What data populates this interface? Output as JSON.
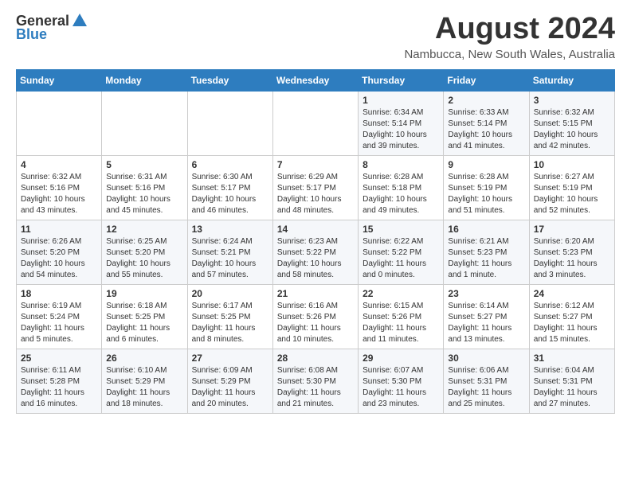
{
  "logo": {
    "general": "General",
    "blue": "Blue"
  },
  "title": "August 2024",
  "subtitle": "Nambucca, New South Wales, Australia",
  "days_of_week": [
    "Sunday",
    "Monday",
    "Tuesday",
    "Wednesday",
    "Thursday",
    "Friday",
    "Saturday"
  ],
  "weeks": [
    [
      {
        "day": "",
        "info": ""
      },
      {
        "day": "",
        "info": ""
      },
      {
        "day": "",
        "info": ""
      },
      {
        "day": "",
        "info": ""
      },
      {
        "day": "1",
        "info": "Sunrise: 6:34 AM\nSunset: 5:14 PM\nDaylight: 10 hours\nand 39 minutes."
      },
      {
        "day": "2",
        "info": "Sunrise: 6:33 AM\nSunset: 5:14 PM\nDaylight: 10 hours\nand 41 minutes."
      },
      {
        "day": "3",
        "info": "Sunrise: 6:32 AM\nSunset: 5:15 PM\nDaylight: 10 hours\nand 42 minutes."
      }
    ],
    [
      {
        "day": "4",
        "info": "Sunrise: 6:32 AM\nSunset: 5:16 PM\nDaylight: 10 hours\nand 43 minutes."
      },
      {
        "day": "5",
        "info": "Sunrise: 6:31 AM\nSunset: 5:16 PM\nDaylight: 10 hours\nand 45 minutes."
      },
      {
        "day": "6",
        "info": "Sunrise: 6:30 AM\nSunset: 5:17 PM\nDaylight: 10 hours\nand 46 minutes."
      },
      {
        "day": "7",
        "info": "Sunrise: 6:29 AM\nSunset: 5:17 PM\nDaylight: 10 hours\nand 48 minutes."
      },
      {
        "day": "8",
        "info": "Sunrise: 6:28 AM\nSunset: 5:18 PM\nDaylight: 10 hours\nand 49 minutes."
      },
      {
        "day": "9",
        "info": "Sunrise: 6:28 AM\nSunset: 5:19 PM\nDaylight: 10 hours\nand 51 minutes."
      },
      {
        "day": "10",
        "info": "Sunrise: 6:27 AM\nSunset: 5:19 PM\nDaylight: 10 hours\nand 52 minutes."
      }
    ],
    [
      {
        "day": "11",
        "info": "Sunrise: 6:26 AM\nSunset: 5:20 PM\nDaylight: 10 hours\nand 54 minutes."
      },
      {
        "day": "12",
        "info": "Sunrise: 6:25 AM\nSunset: 5:20 PM\nDaylight: 10 hours\nand 55 minutes."
      },
      {
        "day": "13",
        "info": "Sunrise: 6:24 AM\nSunset: 5:21 PM\nDaylight: 10 hours\nand 57 minutes."
      },
      {
        "day": "14",
        "info": "Sunrise: 6:23 AM\nSunset: 5:22 PM\nDaylight: 10 hours\nand 58 minutes."
      },
      {
        "day": "15",
        "info": "Sunrise: 6:22 AM\nSunset: 5:22 PM\nDaylight: 11 hours\nand 0 minutes."
      },
      {
        "day": "16",
        "info": "Sunrise: 6:21 AM\nSunset: 5:23 PM\nDaylight: 11 hours\nand 1 minute."
      },
      {
        "day": "17",
        "info": "Sunrise: 6:20 AM\nSunset: 5:23 PM\nDaylight: 11 hours\nand 3 minutes."
      }
    ],
    [
      {
        "day": "18",
        "info": "Sunrise: 6:19 AM\nSunset: 5:24 PM\nDaylight: 11 hours\nand 5 minutes."
      },
      {
        "day": "19",
        "info": "Sunrise: 6:18 AM\nSunset: 5:25 PM\nDaylight: 11 hours\nand 6 minutes."
      },
      {
        "day": "20",
        "info": "Sunrise: 6:17 AM\nSunset: 5:25 PM\nDaylight: 11 hours\nand 8 minutes."
      },
      {
        "day": "21",
        "info": "Sunrise: 6:16 AM\nSunset: 5:26 PM\nDaylight: 11 hours\nand 10 minutes."
      },
      {
        "day": "22",
        "info": "Sunrise: 6:15 AM\nSunset: 5:26 PM\nDaylight: 11 hours\nand 11 minutes."
      },
      {
        "day": "23",
        "info": "Sunrise: 6:14 AM\nSunset: 5:27 PM\nDaylight: 11 hours\nand 13 minutes."
      },
      {
        "day": "24",
        "info": "Sunrise: 6:12 AM\nSunset: 5:27 PM\nDaylight: 11 hours\nand 15 minutes."
      }
    ],
    [
      {
        "day": "25",
        "info": "Sunrise: 6:11 AM\nSunset: 5:28 PM\nDaylight: 11 hours\nand 16 minutes."
      },
      {
        "day": "26",
        "info": "Sunrise: 6:10 AM\nSunset: 5:29 PM\nDaylight: 11 hours\nand 18 minutes."
      },
      {
        "day": "27",
        "info": "Sunrise: 6:09 AM\nSunset: 5:29 PM\nDaylight: 11 hours\nand 20 minutes."
      },
      {
        "day": "28",
        "info": "Sunrise: 6:08 AM\nSunset: 5:30 PM\nDaylight: 11 hours\nand 21 minutes."
      },
      {
        "day": "29",
        "info": "Sunrise: 6:07 AM\nSunset: 5:30 PM\nDaylight: 11 hours\nand 23 minutes."
      },
      {
        "day": "30",
        "info": "Sunrise: 6:06 AM\nSunset: 5:31 PM\nDaylight: 11 hours\nand 25 minutes."
      },
      {
        "day": "31",
        "info": "Sunrise: 6:04 AM\nSunset: 5:31 PM\nDaylight: 11 hours\nand 27 minutes."
      }
    ]
  ]
}
